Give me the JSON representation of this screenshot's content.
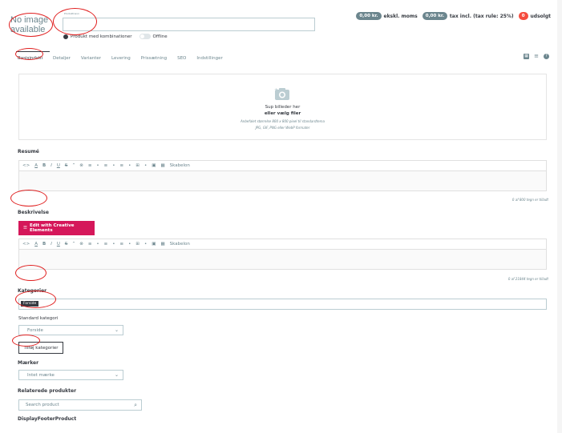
{
  "header": {
    "no_image": "No image available",
    "name_label_tiny": "Produktnavn",
    "combo_label": "Produkt med kombinationer",
    "offline_label": "Offline",
    "price_excl": "0,00 kr.",
    "price_excl_label": "ekskl. moms",
    "price_incl": "0,00 kr.",
    "price_incl_label": "tax incl. (tax rule: 25%)",
    "sold_count": "0",
    "sold_label": "udsolgt"
  },
  "tabs": [
    {
      "label": "Basisindstil"
    },
    {
      "label": "Detaljer"
    },
    {
      "label": "Varianter"
    },
    {
      "label": "Levering"
    },
    {
      "label": "Prissætning"
    },
    {
      "label": "SEO"
    },
    {
      "label": "Indstillinger"
    }
  ],
  "dropzone": {
    "line1": "Sup billeder her",
    "line2": "eller vælg filer",
    "line3": "Anbefalet størrelse 800 x 800 pixel til standardtema",
    "line4": "JPG, GIF, PNG eller WebP formater"
  },
  "summary": {
    "title": "Resumé",
    "counter": "0 af 800 tegn er tilladt"
  },
  "description": {
    "title": "Beskrivelse",
    "ce_button": "Edit with Creative Elements",
    "counter": "0 af 21844 tegn er tilladt"
  },
  "editor_toolbar": {
    "items": [
      "<>",
      "A",
      "B",
      "I",
      "U",
      "S",
      "”",
      "⊗",
      "≡",
      "•",
      "≡",
      "•",
      "≡",
      "•",
      "⊞",
      "•",
      "▣",
      "▦",
      "Skabelon"
    ]
  },
  "categories": {
    "title": "Kategorier",
    "tag": "Forside",
    "default_label": "Standard kategori",
    "default_value": "Forside",
    "add_button": "Tilføj kategorier"
  },
  "brand": {
    "title": "Mærker",
    "value": "Intet mærke"
  },
  "related": {
    "title": "Relaterede produkter",
    "placeholder": "Search product"
  },
  "footer_hook": {
    "title": "DisplayFooterProduct"
  },
  "colors": {
    "accent": "#d5175a",
    "pill": "#6c868e",
    "alert": "#f54c3e",
    "annotation": "#e01e1e"
  }
}
